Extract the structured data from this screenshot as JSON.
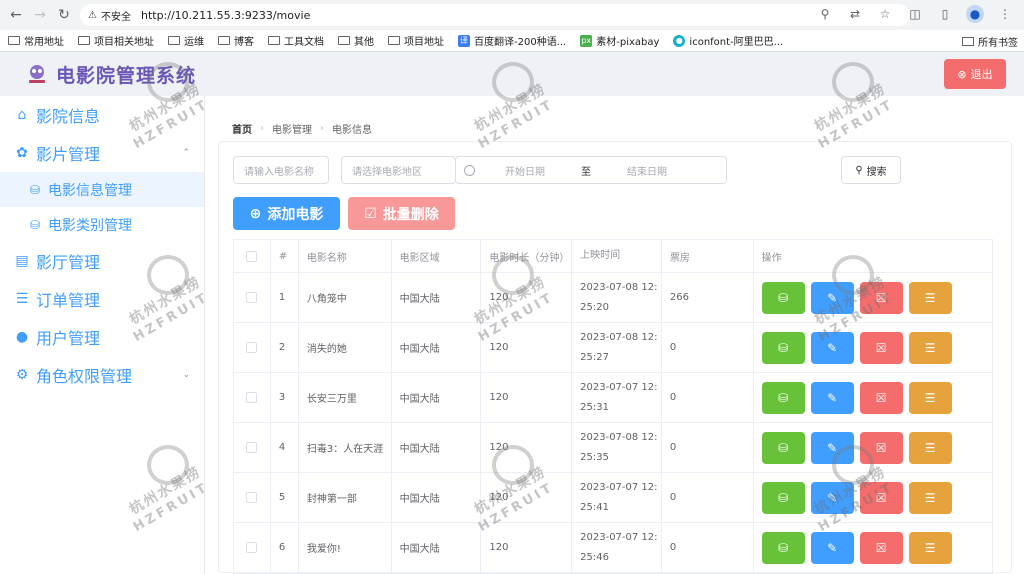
{
  "browser": {
    "insecure_label": "不安全",
    "url": "http://10.211.55.3:9233/movie",
    "bookmarks": [
      "常用地址",
      "项目相关地址",
      "运维",
      "博客",
      "工具文档",
      "其他",
      "项目地址",
      "百度翻译-200种语...",
      "素材-pixabay",
      "iconfont-阿里巴巴..."
    ],
    "all_bookmarks": "所有书签"
  },
  "header": {
    "title": "电影院管理系统",
    "logout": "退出"
  },
  "sidebar": {
    "items": [
      {
        "label": "影院信息",
        "icon": "home-icon"
      },
      {
        "label": "影片管理",
        "icon": "film-reel-icon"
      },
      {
        "label": "影厅管理",
        "icon": "film-strip-icon"
      },
      {
        "label": "订单管理",
        "icon": "list-icon"
      },
      {
        "label": "用户管理",
        "icon": "user-icon"
      },
      {
        "label": "角色权限管理",
        "icon": "user-settings-icon"
      }
    ],
    "sub_items": [
      {
        "label": "电影信息管理"
      },
      {
        "label": "电影类别管理"
      }
    ]
  },
  "breadcrumb": [
    "首页",
    "电影管理",
    "电影信息"
  ],
  "filters": {
    "name_placeholder": "请输入电影名称",
    "region_placeholder": "请选择电影地区",
    "start_placeholder": "开始日期",
    "to": "至",
    "end_placeholder": "结束日期",
    "search": "搜索"
  },
  "actions": {
    "add": "添加电影",
    "batch_delete": "批量删除"
  },
  "table": {
    "headers": [
      "#",
      "电影名称",
      "电影区域",
      "电影时长（分钟）",
      "上映时间",
      "票房",
      "操作"
    ],
    "rows": [
      {
        "id": "1",
        "name": "八角笼中",
        "region": "中国大陆",
        "duration": "120",
        "date": "2023-07-08 12:",
        "time": "25:20",
        "box": "266"
      },
      {
        "id": "2",
        "name": "消失的她",
        "region": "中国大陆",
        "duration": "120",
        "date": "2023-07-08 12:",
        "time": "25:27",
        "box": "0"
      },
      {
        "id": "3",
        "name": "长安三万里",
        "region": "中国大陆",
        "duration": "120",
        "date": "2023-07-07 12:",
        "time": "25:31",
        "box": "0"
      },
      {
        "id": "4",
        "name": "扫毒3：人在天涯",
        "region": "中国大陆",
        "duration": "120",
        "date": "2023-07-08 12:",
        "time": "25:35",
        "box": "0"
      },
      {
        "id": "5",
        "name": "封神第一部",
        "region": "中国大陆",
        "duration": "120",
        "date": "2023-07-07 12:",
        "time": "25:41",
        "box": "0"
      },
      {
        "id": "6",
        "name": "我爱你!",
        "region": "中国大陆",
        "duration": "120",
        "date": "2023-07-07 12:",
        "time": "25:46",
        "box": "0"
      }
    ]
  },
  "watermark": {
    "line1": "杭州水果捞",
    "line2": "HZFRUIT"
  }
}
